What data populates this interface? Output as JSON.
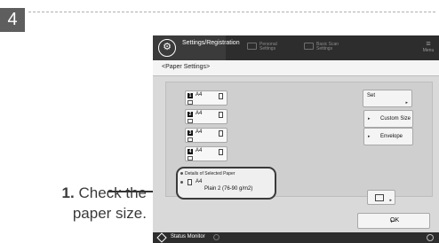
{
  "step": {
    "number": "4"
  },
  "callout": {
    "number": "1.",
    "text_line1": " Check the",
    "text_line2": "paper size."
  },
  "screen": {
    "topbar": {
      "title": "Settings/Registration",
      "tab2": "Personal Settings",
      "tab3": "Basic Scan Settings",
      "menu_label": "Menu",
      "icons": [
        "gear-icon",
        "personal-settings-icon",
        "basic-scan-icon",
        "menu-icon"
      ]
    },
    "subheader": "<Paper Settings>",
    "trays": [
      {
        "number": "1",
        "size": "A4"
      },
      {
        "number": "2",
        "size": "A4"
      },
      {
        "number": "3",
        "size": "A4"
      },
      {
        "number": "4",
        "size": "A4"
      }
    ],
    "buttons": {
      "set": "Set",
      "custom_size": "Custom Size",
      "envelope": "Envelope",
      "ok": "OK"
    },
    "details": {
      "header": "Details of Selected Paper",
      "size": "A4",
      "paper_type": "Plain 2 (76-90 g/m2)"
    },
    "bottombar": {
      "status_monitor": "Status Monitor"
    },
    "colors": {
      "topbar": "#2d2d2d",
      "panel": "#cfcfcf",
      "highlight_border": "#3a3a3a"
    }
  }
}
